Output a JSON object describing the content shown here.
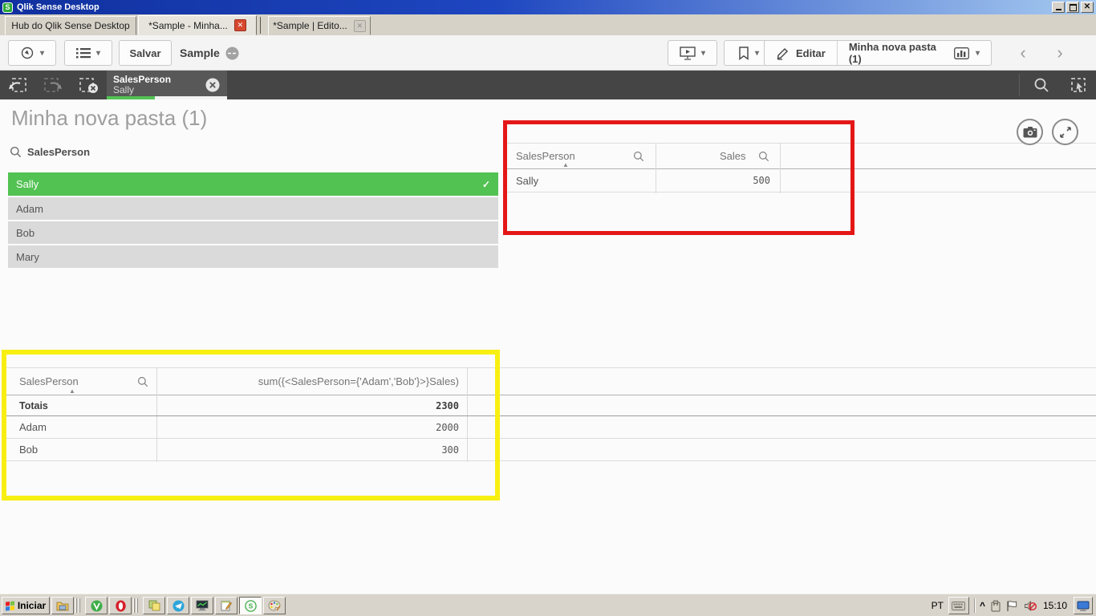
{
  "window": {
    "title": "Qlik Sense Desktop"
  },
  "tabs": {
    "items": [
      {
        "label": "Hub do Qlik Sense Desktop"
      },
      {
        "label": "*Sample - Minha..."
      },
      {
        "label": "*Sample | Edito..."
      }
    ],
    "close_glyph": "✕"
  },
  "toolbar": {
    "save_label": "Salvar",
    "app_name": "Sample",
    "edit_label": "Editar",
    "sheet_selector_label": "Minha nova pasta (1)",
    "caret_glyph": "▾",
    "back_glyph": "‹",
    "forward_glyph": "›"
  },
  "selection_bar": {
    "selection": {
      "field": "SalesPerson",
      "value": "Sally"
    }
  },
  "sheet": {
    "title": "Minha nova pasta (1)"
  },
  "filter_pane": {
    "field_label": "SalesPerson",
    "check_glyph": "✓",
    "sort_glyph": "▲",
    "items": [
      {
        "label": "Sally",
        "state": "selected"
      },
      {
        "label": "Adam",
        "state": "possible"
      },
      {
        "label": "Bob",
        "state": "possible"
      },
      {
        "label": "Mary",
        "state": "possible"
      }
    ]
  },
  "table_sales": {
    "columns": [
      {
        "label": "SalesPerson"
      },
      {
        "label": "Sales"
      }
    ],
    "rows": [
      {
        "person": "Sally",
        "value": "500"
      }
    ]
  },
  "table_setanalysis": {
    "columns": [
      {
        "label": "SalesPerson"
      },
      {
        "label": "sum({<SalesPerson={'Adam','Bob'}>}Sales)"
      }
    ],
    "totals": {
      "label": "Totais",
      "value": "2300"
    },
    "rows": [
      {
        "person": "Adam",
        "value": "2000"
      },
      {
        "person": "Bob",
        "value": "300"
      }
    ]
  },
  "annotations": {
    "red_box_color": "#e41717",
    "yellow_box_color": "#f8ef12"
  },
  "taskbar": {
    "start_label": "Iniciar",
    "tray": {
      "language": "PT",
      "collapse_glyph": "^",
      "time": "15:10"
    }
  }
}
